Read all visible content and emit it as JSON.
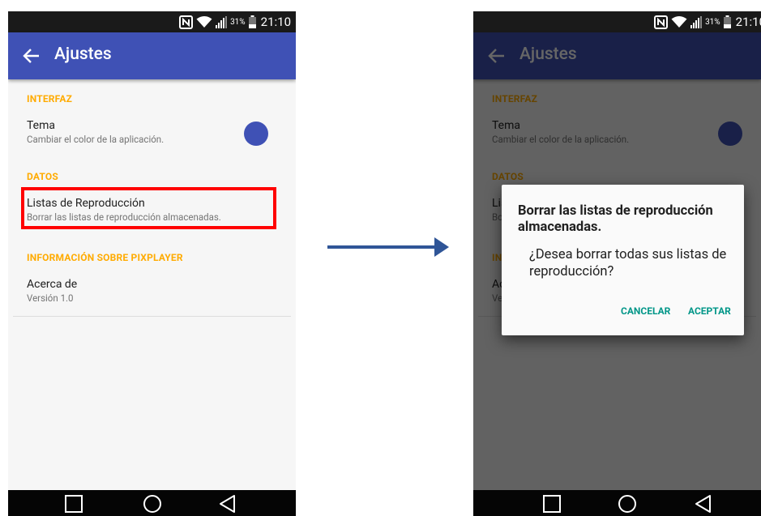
{
  "status_bar": {
    "battery_percent": "31%",
    "time": "21:10",
    "icons": [
      "nfc-icon",
      "wifi-icon",
      "signal-icon",
      "battery-icon"
    ]
  },
  "app_bar": {
    "title": "Ajustes",
    "back_icon": "arrow-back-icon"
  },
  "sections": {
    "interfaz": {
      "header": "INTERFAZ",
      "theme": {
        "title": "Tema",
        "summary": "Cambiar el color de la aplicación."
      }
    },
    "datos": {
      "header": "DATOS",
      "playlists": {
        "title": "Listas de Reproducción",
        "summary": "Borrar las listas de reproducción almacenadas."
      }
    },
    "info": {
      "header": "INFORMACIÓN SOBRE PIXPLAYER",
      "about": {
        "title": "Acerca de",
        "summary": "Versión 1.0"
      }
    }
  },
  "dialog": {
    "title": "Borrar las listas de reproducción almacenadas.",
    "message": "¿Desea borrar todas sus listas de reproducción?",
    "cancel": "CANCELAR",
    "accept": "ACEPTAR"
  },
  "nav_bar": {
    "buttons": [
      "recents-icon",
      "home-icon",
      "back-icon"
    ]
  },
  "colors": {
    "primary": "#3f51b5",
    "accent": "#ffab00",
    "dialog_button": "#009688",
    "highlight": "#ff0000",
    "transition_arrow": "#2f5597"
  }
}
